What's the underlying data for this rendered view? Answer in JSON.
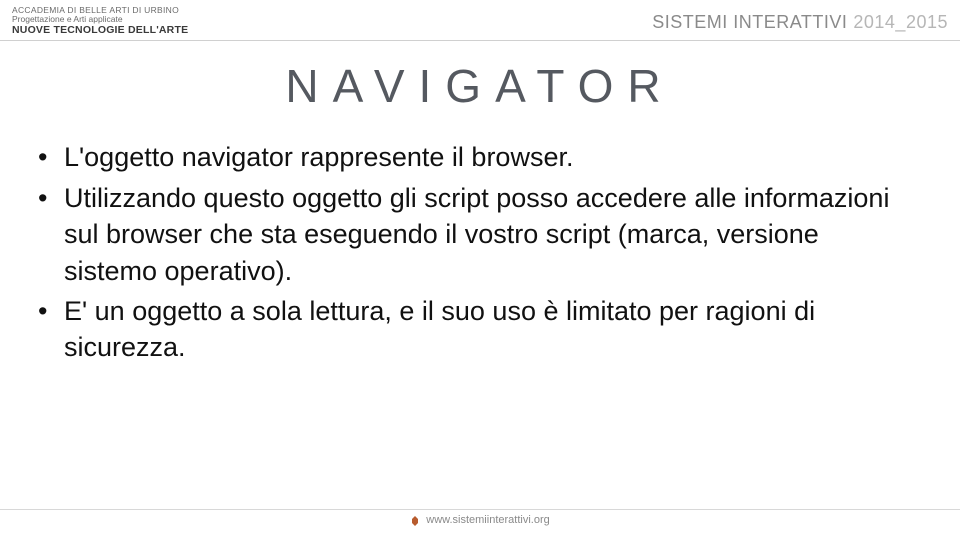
{
  "header": {
    "left": {
      "line1": "ACCADEMIA DI BELLE ARTI DI URBINO",
      "line2": "Progettazione e Arti applicate",
      "line3": "NUOVE TECNOLOGIE DELL'ARTE"
    },
    "right": {
      "title": "SISTEMI INTERATTIVI",
      "year": "2014_2015"
    }
  },
  "title": "NAVIGATOR",
  "bullets": [
    "L'oggetto navigator rappresente il browser.",
    "Utilizzando questo oggetto gli script posso accedere alle informazioni sul browser che sta eseguendo il vostro script (marca, versione sistemo operativo).",
    "E' un oggetto a sola lettura, e il suo uso è limitato per ragioni di sicurezza."
  ],
  "footer": {
    "url": "www.sistemiinterattivi.org"
  }
}
